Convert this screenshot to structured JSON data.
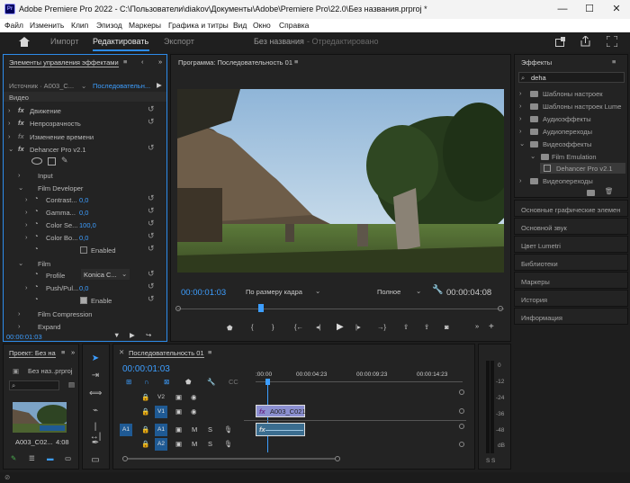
{
  "window": {
    "app_icon": "Pr",
    "title": "Adobe Premiere Pro 2022 - C:\\Пользователи\\diakov\\Документы\\Adobe\\Premiere Pro\\22.0\\Без названия.prproj *",
    "minimize": "—",
    "maximize": "☐",
    "close": "✕"
  },
  "menu": [
    "Файл",
    "Изменить",
    "Клип",
    "Эпизод",
    "Маркеры",
    "Графика и титры",
    "Вид",
    "Окно",
    "Справка"
  ],
  "workspace": {
    "tabs": [
      "Импорт",
      "Редактировать",
      "Экспорт"
    ],
    "active": "Редактировать",
    "project_name": "Без названия",
    "status": "- Отредактировано"
  },
  "effect_controls": {
    "panel_title": "Элементы управления эффектами",
    "menu_icon": "≡",
    "source": "Источник · A003_C...",
    "sequence": "Последовательн...",
    "section": "Видео",
    "effects": [
      "Движение",
      "Непрозрачность",
      "Изменение времени",
      "Dehancer Pro v2.1"
    ],
    "groups": {
      "input": "Input",
      "film_developer": "Film Developer",
      "film": "Film",
      "film_compression": "Film Compression",
      "expand": "Expand"
    },
    "params": [
      {
        "name": "Contrast...",
        "value": "0,0"
      },
      {
        "name": "Gamma...",
        "value": "0,0"
      },
      {
        "name": "Color Se...",
        "value": "100,0"
      },
      {
        "name": "Color Bo...",
        "value": "0,0"
      }
    ],
    "enabled_label": "Enabled",
    "profile_label": "Profile",
    "profile_value": "Konica C...",
    "push_label": "Push/Pul...",
    "push_value": "0,0",
    "enable_label": "Enable",
    "timecode": "00:00:01:03"
  },
  "program": {
    "title": "Программа: Последовательность 01",
    "timecode": "00:00:01:03",
    "fit": "По размеру кадра",
    "quality": "Полное",
    "duration": "00:00:04:08"
  },
  "effects_panel": {
    "title": "Эффекты",
    "search": "deha",
    "items": [
      {
        "label": "Шаблоны настроек",
        "level": 0,
        "open": false
      },
      {
        "label": "Шаблоны настроек Lume",
        "level": 0,
        "open": false
      },
      {
        "label": "Аудиоэффекты",
        "level": 0,
        "open": false
      },
      {
        "label": "Аудиопереходы",
        "level": 0,
        "open": false
      },
      {
        "label": "Видеоэффекты",
        "level": 0,
        "open": true
      },
      {
        "label": "Film Emulation",
        "level": 1,
        "open": true
      },
      {
        "label": "Dehancer Pro v2.1",
        "level": 2,
        "open": false
      },
      {
        "label": "Видеопереходы",
        "level": 0,
        "open": false
      }
    ]
  },
  "side_panels": [
    "Основные графические элемен",
    "Основной звук",
    "Цвет Lumetri",
    "Библиотеки",
    "Маркеры",
    "История",
    "Информация"
  ],
  "project": {
    "title": "Проект: Без на",
    "menu_icon": "≡",
    "file": "Без наз..prproj",
    "clip_name": "A003_C02...",
    "clip_dur": "4:08"
  },
  "timeline": {
    "title": "Последовательность 01",
    "timecode": "00:00:01:03",
    "ruler": [
      ":00:00",
      "00:00:04:23",
      "00:00:09:23",
      "00:00:14:23"
    ],
    "tracks": [
      {
        "label": "V2",
        "active": false
      },
      {
        "label": "V1",
        "active": true
      },
      {
        "label": "A1",
        "active": true
      },
      {
        "label": "A2",
        "active": true
      }
    ],
    "clip_label": "A003_C021",
    "fx_label": "fx"
  },
  "meter": {
    "labels": [
      "0",
      "-12",
      "-24",
      "-36",
      "-48",
      "dB"
    ],
    "solo": [
      "S",
      "S"
    ]
  }
}
